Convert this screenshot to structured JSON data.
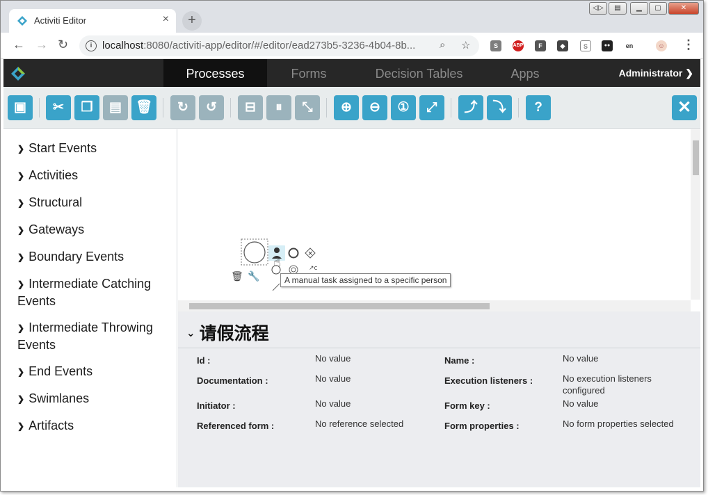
{
  "browser": {
    "tab_title": "Activiti Editor",
    "tab_close": "×",
    "new_tab": "+",
    "url_host": "localhost",
    "url_rest": ":8080/activiti-app/editor/#/editor/ead273b5-3236-4b04-8b...",
    "extensions": [
      {
        "name": "s-extension-icon",
        "label": "S",
        "color": "#7d7d7d"
      },
      {
        "name": "adblock-icon",
        "label": "ABP",
        "color": "#d22020"
      },
      {
        "name": "f-extension-icon",
        "label": "F",
        "color": "#555555"
      },
      {
        "name": "diamond-extension-icon",
        "label": "◆",
        "color": "#444444"
      },
      {
        "name": "shield-extension-icon",
        "label": "S",
        "color": "#888888"
      },
      {
        "name": "glasses-extension-icon",
        "label": "●●",
        "color": "#222222"
      },
      {
        "name": "translate-extension-icon",
        "label": "en",
        "color": "#555555"
      }
    ]
  },
  "app": {
    "nav_tabs": [
      "Processes",
      "Forms",
      "Decision Tables",
      "Apps"
    ],
    "user": "Administrator"
  },
  "palette": {
    "items": [
      "Start Events",
      "Activities",
      "Structural",
      "Gateways",
      "Boundary Events",
      "Intermediate Catching Events",
      "Intermediate Throwing Events",
      "End Events",
      "Swimlanes",
      "Artifacts"
    ]
  },
  "canvas": {
    "tooltip": "A manual task assigned to a specific person"
  },
  "properties": {
    "title": "请假流程",
    "left": [
      {
        "label": "Id :",
        "value": "No value"
      },
      {
        "label": "Documentation :",
        "value": "No value"
      },
      {
        "label": "Initiator :",
        "value": "No value"
      },
      {
        "label": "Referenced form :",
        "value": "No reference selected"
      }
    ],
    "right": [
      {
        "label": "Name :",
        "value": "No value"
      },
      {
        "label": "Execution listeners :",
        "value": "No execution listeners configured"
      },
      {
        "label": "Form key :",
        "value": "No value"
      },
      {
        "label": "Form properties :",
        "value": "No form properties selected"
      }
    ]
  },
  "colors": {
    "accent": "#3aa3c9",
    "disabled": "#9bb3bc",
    "header_bg": "#272727"
  }
}
